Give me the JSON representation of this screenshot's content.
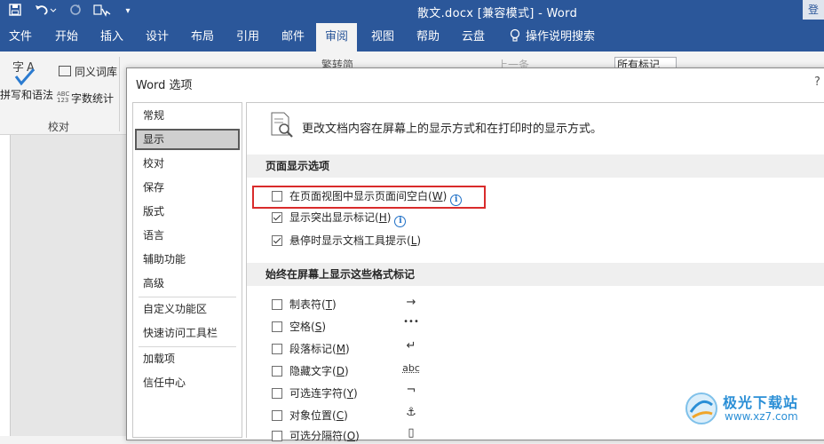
{
  "titlebar": {
    "title": "散文.docx [兼容模式]  -  Word",
    "login": "登"
  },
  "tabs": [
    "文件",
    "开始",
    "插入",
    "设计",
    "布局",
    "引用",
    "邮件",
    "审阅",
    "视图",
    "帮助",
    "云盘",
    "操作说明搜索"
  ],
  "active_tab": "审阅",
  "ribbon": {
    "spelling": "拼写和语法",
    "thesaurus": "同义词库",
    "wordcount": "字数统计",
    "group_label": "校对",
    "trad_simp": "繁转简",
    "prev": "上一条",
    "markup_combo": "所有标记"
  },
  "dialog": {
    "title": "Word 选项",
    "help": "?",
    "nav": [
      "常规",
      "显示",
      "校对",
      "保存",
      "版式",
      "语言",
      "辅助功能",
      "高级",
      "自定义功能区",
      "快速访问工具栏",
      "加载项",
      "信任中心"
    ],
    "selected_nav": "显示",
    "intro": "更改文档内容在屏幕上的显示方式和在打印时的显示方式。",
    "section1": {
      "header": "页面显示选项",
      "options": [
        {
          "label": "在页面视图中显示页面间空白(",
          "key": "W",
          "suffix": ")",
          "checked": false,
          "info": true
        },
        {
          "label": "显示突出显示标记(",
          "key": "H",
          "suffix": ")",
          "checked": true,
          "info": true
        },
        {
          "label": "悬停时显示文档工具提示(",
          "key": "L",
          "suffix": ")",
          "checked": true,
          "info": false
        }
      ]
    },
    "section2": {
      "header": "始终在屏幕上显示这些格式标记",
      "options": [
        {
          "label": "制表符(",
          "key": "T",
          "suffix": ")",
          "checked": false,
          "symbol": "→"
        },
        {
          "label": "空格(",
          "key": "S",
          "suffix": ")",
          "checked": false,
          "symbol": "•••"
        },
        {
          "label": "段落标记(",
          "key": "M",
          "suffix": ")",
          "checked": false,
          "symbol": "↵"
        },
        {
          "label": "隐藏文字(",
          "key": "D",
          "suffix": ")",
          "checked": false,
          "symbol": "abc"
        },
        {
          "label": "可选连字符(",
          "key": "Y",
          "suffix": ")",
          "checked": false,
          "symbol": "¬"
        },
        {
          "label": "对象位置(",
          "key": "C",
          "suffix": ")",
          "checked": false,
          "symbol": "⚓"
        },
        {
          "label": "可选分隔符(",
          "key": "O",
          "suffix": ")",
          "checked": false,
          "symbol": "▯"
        }
      ]
    }
  },
  "watermark": {
    "name": "极光下载站",
    "url": "www.xz7.com"
  },
  "colors": {
    "word_blue": "#2b579a",
    "highlight_red": "#d92b2b",
    "info_blue": "#1e6fc6"
  }
}
